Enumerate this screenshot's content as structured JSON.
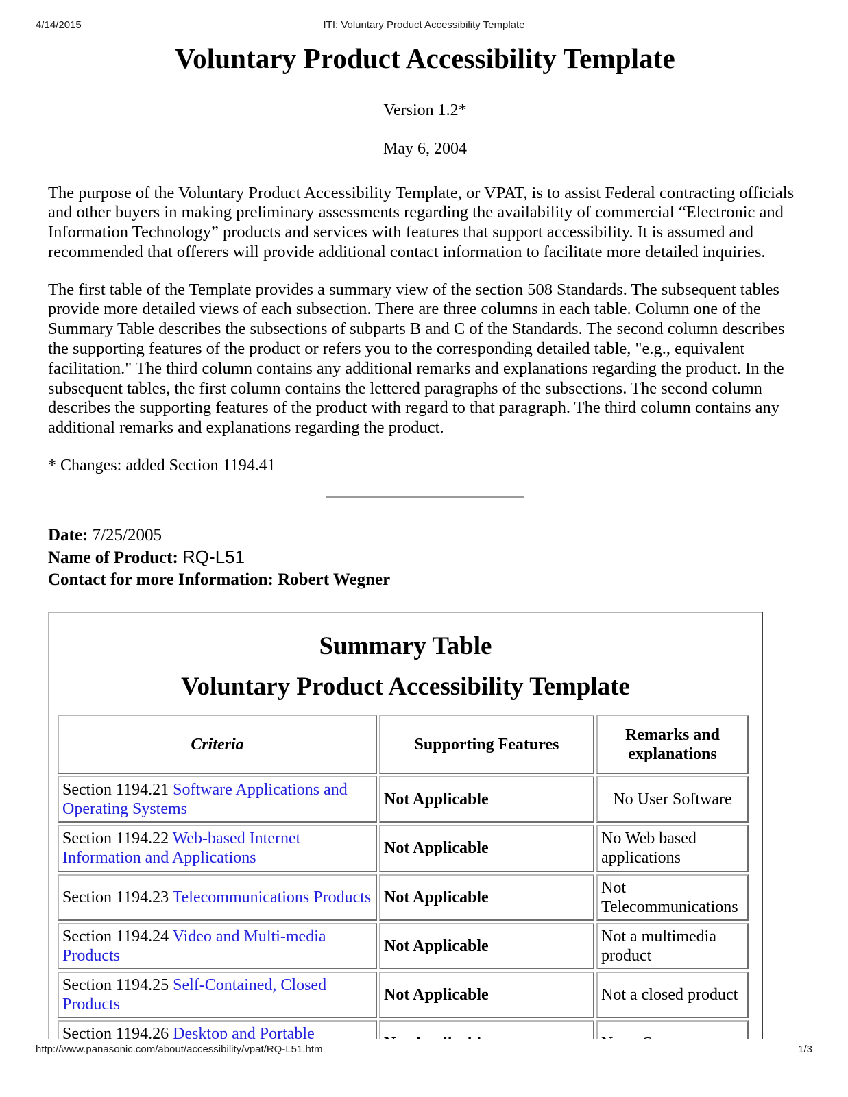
{
  "print_header": {
    "date": "4/14/2015",
    "title": "ITI: Voluntary Product Accessibility Template"
  },
  "document": {
    "title": "Voluntary Product Accessibility Template",
    "version": "Version 1.2*",
    "date": "May 6, 2004",
    "paragraph_1": "The purpose of the Voluntary Product Accessibility Template, or VPAT, is to assist Federal contracting officials and other buyers in making preliminary assessments regarding the availability of commercial “Electronic and Information Technology” products and services with features that support accessibility. It is assumed and recommended that offerers will provide additional contact information to facilitate more detailed inquiries.",
    "paragraph_2": "The first table of the Template provides a summary view of the section 508 Standards. The subsequent tables provide more detailed views of each subsection. There are three columns in each table. Column one of the Summary Table describes the subsections of subparts B and C of the Standards. The second column describes the supporting features of the product or refers you to the corresponding detailed table, \"e.g., equivalent facilitation.\" The third column contains any additional remarks and explanations regarding the product. In the subsequent tables, the first column contains the lettered paragraphs of the subsections. The second column describes the supporting features of the product with regard to that paragraph. The third column contains any additional remarks and explanations regarding the product.",
    "changes_note": "* Changes: added Section 1194.41"
  },
  "meta": {
    "date_label": "Date:",
    "date_value": "7/25/2005",
    "product_label": "Name of Product:",
    "product_value": "RQ-L51",
    "contact_label": "Contact for more Information:",
    "contact_value": "Robert Wegner"
  },
  "summary_table": {
    "caption_line_1": "Summary Table",
    "caption_line_2": "Voluntary Product Accessibility Template",
    "headers": {
      "criteria": "Criteria",
      "supporting_features": "Supporting Features",
      "remarks": "Remarks and explanations"
    },
    "link_color": "#2222dd",
    "rows": [
      {
        "criteria_prefix": "Section 1194.21 ",
        "criteria_link": "Software Applications and Operating Systems",
        "supporting_features": "Not Applicable",
        "remarks": "No User Software"
      },
      {
        "criteria_prefix": "Section 1194.22 ",
        "criteria_link": "Web-based Internet Information and Applications",
        "supporting_features": "Not Applicable",
        "remarks": "No Web based applications"
      },
      {
        "criteria_prefix": "Section 1194.23 ",
        "criteria_link": "Telecommunications Products",
        "supporting_features": "Not Applicable",
        "remarks": "Not Telecommunications"
      },
      {
        "criteria_prefix": "Section 1194.24 ",
        "criteria_link": "Video and Multi-media Products",
        "supporting_features": "Not Applicable",
        "remarks": "Not a multimedia product"
      },
      {
        "criteria_prefix": "Section 1194.25 ",
        "criteria_link": "Self-Contained, Closed Products",
        "supporting_features": "Not Applicable",
        "remarks": "Not a closed product"
      },
      {
        "criteria_prefix": "Section 1194.26 ",
        "criteria_link": "Desktop and Portable Computers",
        "supporting_features": "Not Applicable",
        "remarks": "Not a Computer"
      }
    ]
  },
  "print_footer": {
    "url": "http://www.panasonic.com/about/accessibility/vpat/RQ-L51.htm",
    "page": "1/3"
  }
}
